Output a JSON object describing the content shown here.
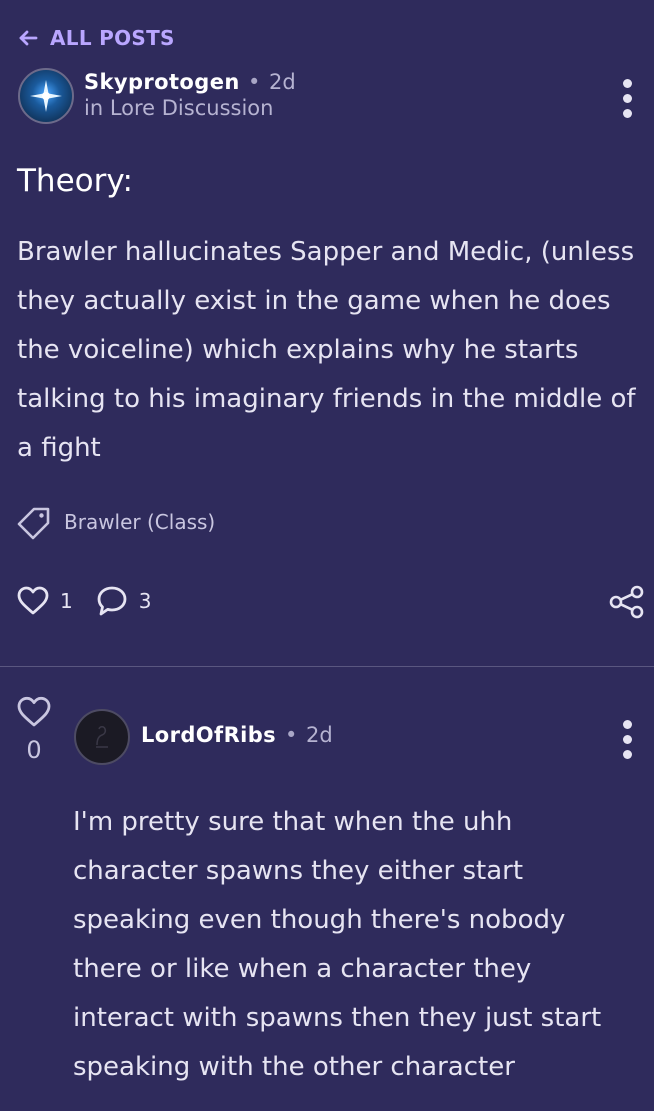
{
  "nav": {
    "back_label": "ALL POSTS"
  },
  "post": {
    "author": "Skyprotogen",
    "time": "2d",
    "community": "in Lore Discussion",
    "title": "Theory:",
    "body": "Brawler hallucinates Sapper and Medic, (unless they actually exist in the game when he does the voiceline) which explains why he starts talking to his imaginary friends in the middle of a fight",
    "tag": "Brawler (Class)",
    "likes": "1",
    "comments": "3"
  },
  "comment": {
    "author": "LordOfRibs",
    "time": "2d",
    "votes": "0",
    "body": "I'm pretty sure that when the uhh character spawns they either start speaking even though there's nobody there or like when a character they interact with spawns then they just start speaking with the other character"
  },
  "colors": {
    "background": "#2f2b5c",
    "accent": "#b9a6ff",
    "text": "#e6e4f2",
    "muted": "#b6b3d1",
    "divider": "#5a5780"
  },
  "icons": {
    "back": "arrow-left-icon",
    "tag": "tag-icon",
    "like": "heart-icon",
    "comment": "chat-bubble-icon",
    "share": "share-icon",
    "more": "kebab-menu-icon"
  }
}
